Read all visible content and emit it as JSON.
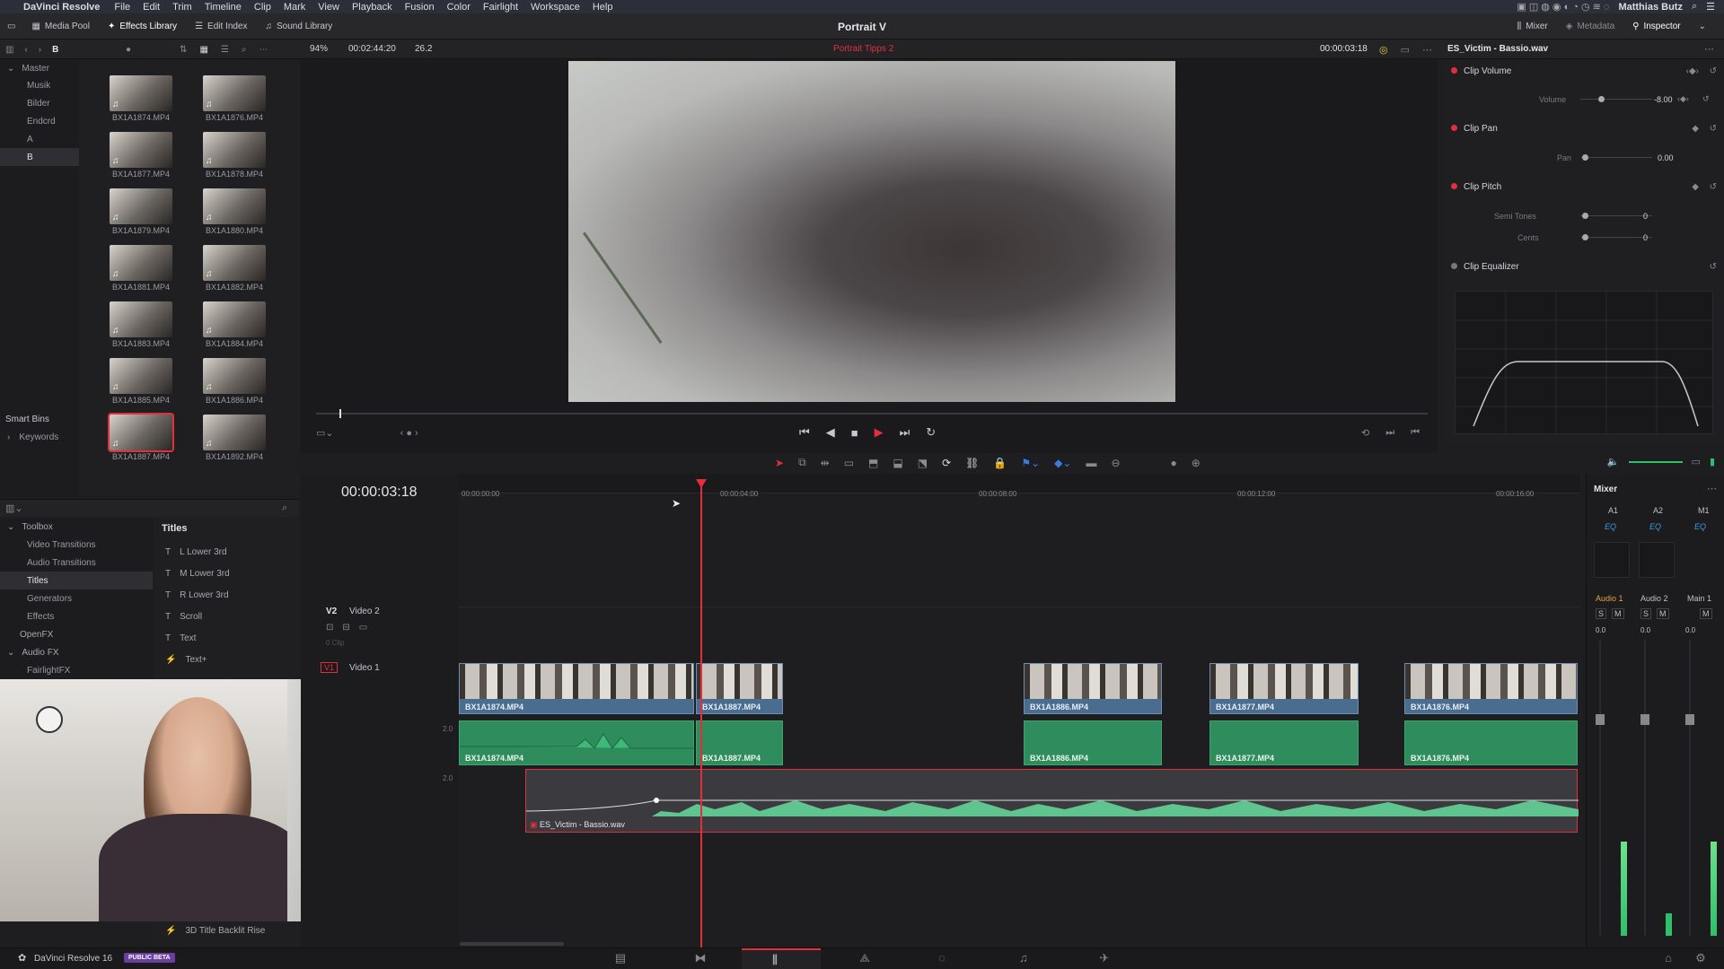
{
  "menubar": {
    "apple": "",
    "app_name": "DaVinci Resolve",
    "items": [
      "File",
      "Edit",
      "Trim",
      "Timeline",
      "Clip",
      "Mark",
      "View",
      "Playback",
      "Fusion",
      "Color",
      "Fairlight",
      "Workspace",
      "Help"
    ],
    "user": "Matthias Butz"
  },
  "topbar": {
    "media_pool": "Media Pool",
    "effects_library": "Effects Library",
    "edit_index": "Edit Index",
    "sound_library": "Sound Library",
    "project_title": "Portrait V",
    "mixer": "Mixer",
    "metadata": "Metadata",
    "inspector": "Inspector"
  },
  "toolbar2": {
    "bin_letter": "B",
    "zoom": "94%",
    "source_timecode": "00:02:44:20",
    "fps": "26.2",
    "timeline_name": "Portrait Tipps 2",
    "viewer_timecode": "00:00:03:18",
    "inspector_clip": "ES_Victim - Bassio.wav"
  },
  "bins": {
    "master": "Master",
    "items": [
      "Musik",
      "Bilder",
      "Endcrd",
      "A",
      "B"
    ],
    "smart_bins": "Smart Bins",
    "keywords": "Keywords"
  },
  "media_clips": [
    "BX1A1874.MP4",
    "BX1A1876.MP4",
    "BX1A1877.MP4",
    "BX1A1878.MP4",
    "BX1A1879.MP4",
    "BX1A1880.MP4",
    "BX1A1881.MP4",
    "BX1A1882.MP4",
    "BX1A1883.MP4",
    "BX1A1884.MP4",
    "BX1A1885.MP4",
    "BX1A1886.MP4",
    "BX1A1887.MP4",
    "BX1A1892.MP4"
  ],
  "toolbox": {
    "root": "Toolbox",
    "items": [
      "Video Transitions",
      "Audio Transitions",
      "Titles",
      "Generators",
      "Effects"
    ],
    "openfx": "OpenFX",
    "audiofx": "Audio FX",
    "fairlightfx": "FairlightFX"
  },
  "titles_panel": {
    "header": "Titles",
    "items": [
      "L Lower 3rd",
      "M Lower 3rd",
      "R Lower 3rd",
      "Scroll",
      "Text",
      "Text+"
    ],
    "bottom_item": "3D Title Backlit Rise"
  },
  "timeline": {
    "timecode": "00:00:03:18",
    "ruler": [
      "00:00:00:00",
      "00:00:04:00",
      "00:00:08:00",
      "00:00:12:00",
      "00:00:16:00"
    ],
    "v2_label": "V2",
    "v2_name": "Video 2",
    "v2_clips": "0 Clip",
    "v1_label": "V1",
    "v1_name": "Video 1",
    "a_level1": "2.0",
    "a_level2": "2.0",
    "video_clips": [
      "BX1A1874.MP4",
      "BX1A1887.MP4",
      "BX1A1886.MP4",
      "BX1A1877.MP4",
      "BX1A1876.MP4"
    ],
    "audio_clips": [
      "BX1A1874.MP4",
      "BX1A1887.MP4",
      "BX1A1886.MP4",
      "BX1A1877.MP4",
      "BX1A1876.MP4"
    ],
    "music_clip": "ES_Victim - Bassio.wav"
  },
  "inspector": {
    "clip_volume": "Clip Volume",
    "volume_label": "Volume",
    "volume_value": "-8.00",
    "clip_pan": "Clip Pan",
    "pan_label": "Pan",
    "pan_value": "0.00",
    "clip_pitch": "Clip Pitch",
    "semitones_label": "Semi Tones",
    "semitones_value": "0",
    "cents_label": "Cents",
    "cents_value": "0",
    "clip_eq": "Clip Equalizer"
  },
  "mixer": {
    "title": "Mixer",
    "channels": [
      "A1",
      "A2",
      "M1"
    ],
    "eq": "EQ",
    "names": [
      "Audio 1",
      "Audio 2",
      "Main 1"
    ],
    "vals": [
      "0.0",
      "0.0",
      "0.0"
    ],
    "solo": "S",
    "mute": "M"
  },
  "bottombar": {
    "app": "DaVinci Resolve 16",
    "badge": "PUBLIC BETA"
  },
  "colors": {
    "accent_red": "#e0303c",
    "video_clip": "#4a6c8e",
    "audio_clip": "#2f8c5c"
  }
}
